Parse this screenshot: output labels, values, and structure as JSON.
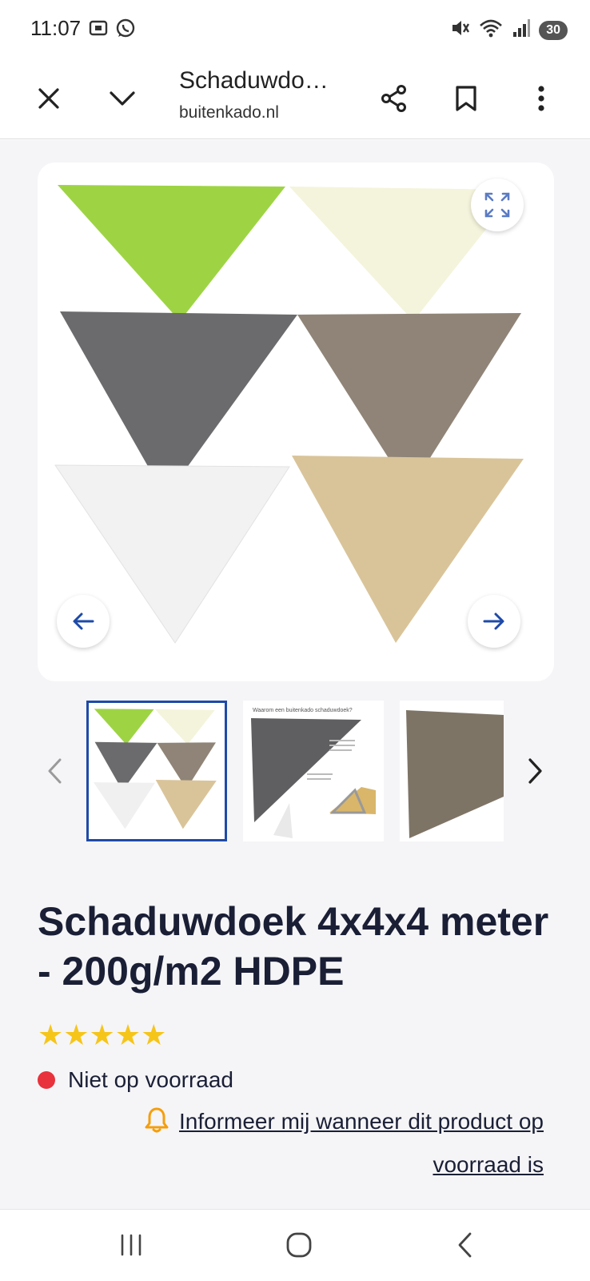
{
  "status_bar": {
    "time": "11:07",
    "battery": "30",
    "icons_left": [
      "screenshot-icon",
      "whatsapp-icon"
    ],
    "icons_right": [
      "mute-icon",
      "wifi-icon",
      "signal-icon",
      "battery-icon"
    ]
  },
  "toolbar": {
    "title": "Schaduwdo…",
    "url": "buitenkado.nl",
    "icons": [
      "close-icon",
      "chevron-down-icon",
      "share-icon",
      "bookmark-icon",
      "more-vertical-icon"
    ]
  },
  "gallery": {
    "main_image": "triangle-shade-sails-six-colors",
    "sail_colors": [
      "#9ed444",
      "#f4f4dc",
      "#6b6b6d",
      "#8f8477",
      "#f2f2f2",
      "#d9c49a"
    ],
    "icons": [
      "expand-icon",
      "arrow-left-icon",
      "arrow-right-icon"
    ],
    "thumbnails": [
      {
        "image": "six-colored-shade-sails",
        "selected": true
      },
      {
        "image": "dark-grey-shade-sail-infographic",
        "selected": false,
        "caption": "Waarom een buitenkado schaduwdoek?"
      },
      {
        "image": "taupe-shade-sail",
        "selected": false
      }
    ],
    "thumb_nav_icons": [
      "chevron-left-icon",
      "chevron-right-icon"
    ]
  },
  "product": {
    "title": "Schaduwdoek 4x4x4 meter - 200g/m2 HDPE",
    "rating": 5,
    "stars": "★★★★★",
    "stock_status": "Niet op voorraad",
    "stock_color": "#e8323c",
    "notify_text": "Informeer mij wanneer dit product op voorraad is",
    "accent_color": "#f59e0b"
  },
  "bottom_nav": {
    "icons": [
      "recent-apps-icon",
      "home-icon",
      "back-icon"
    ]
  }
}
